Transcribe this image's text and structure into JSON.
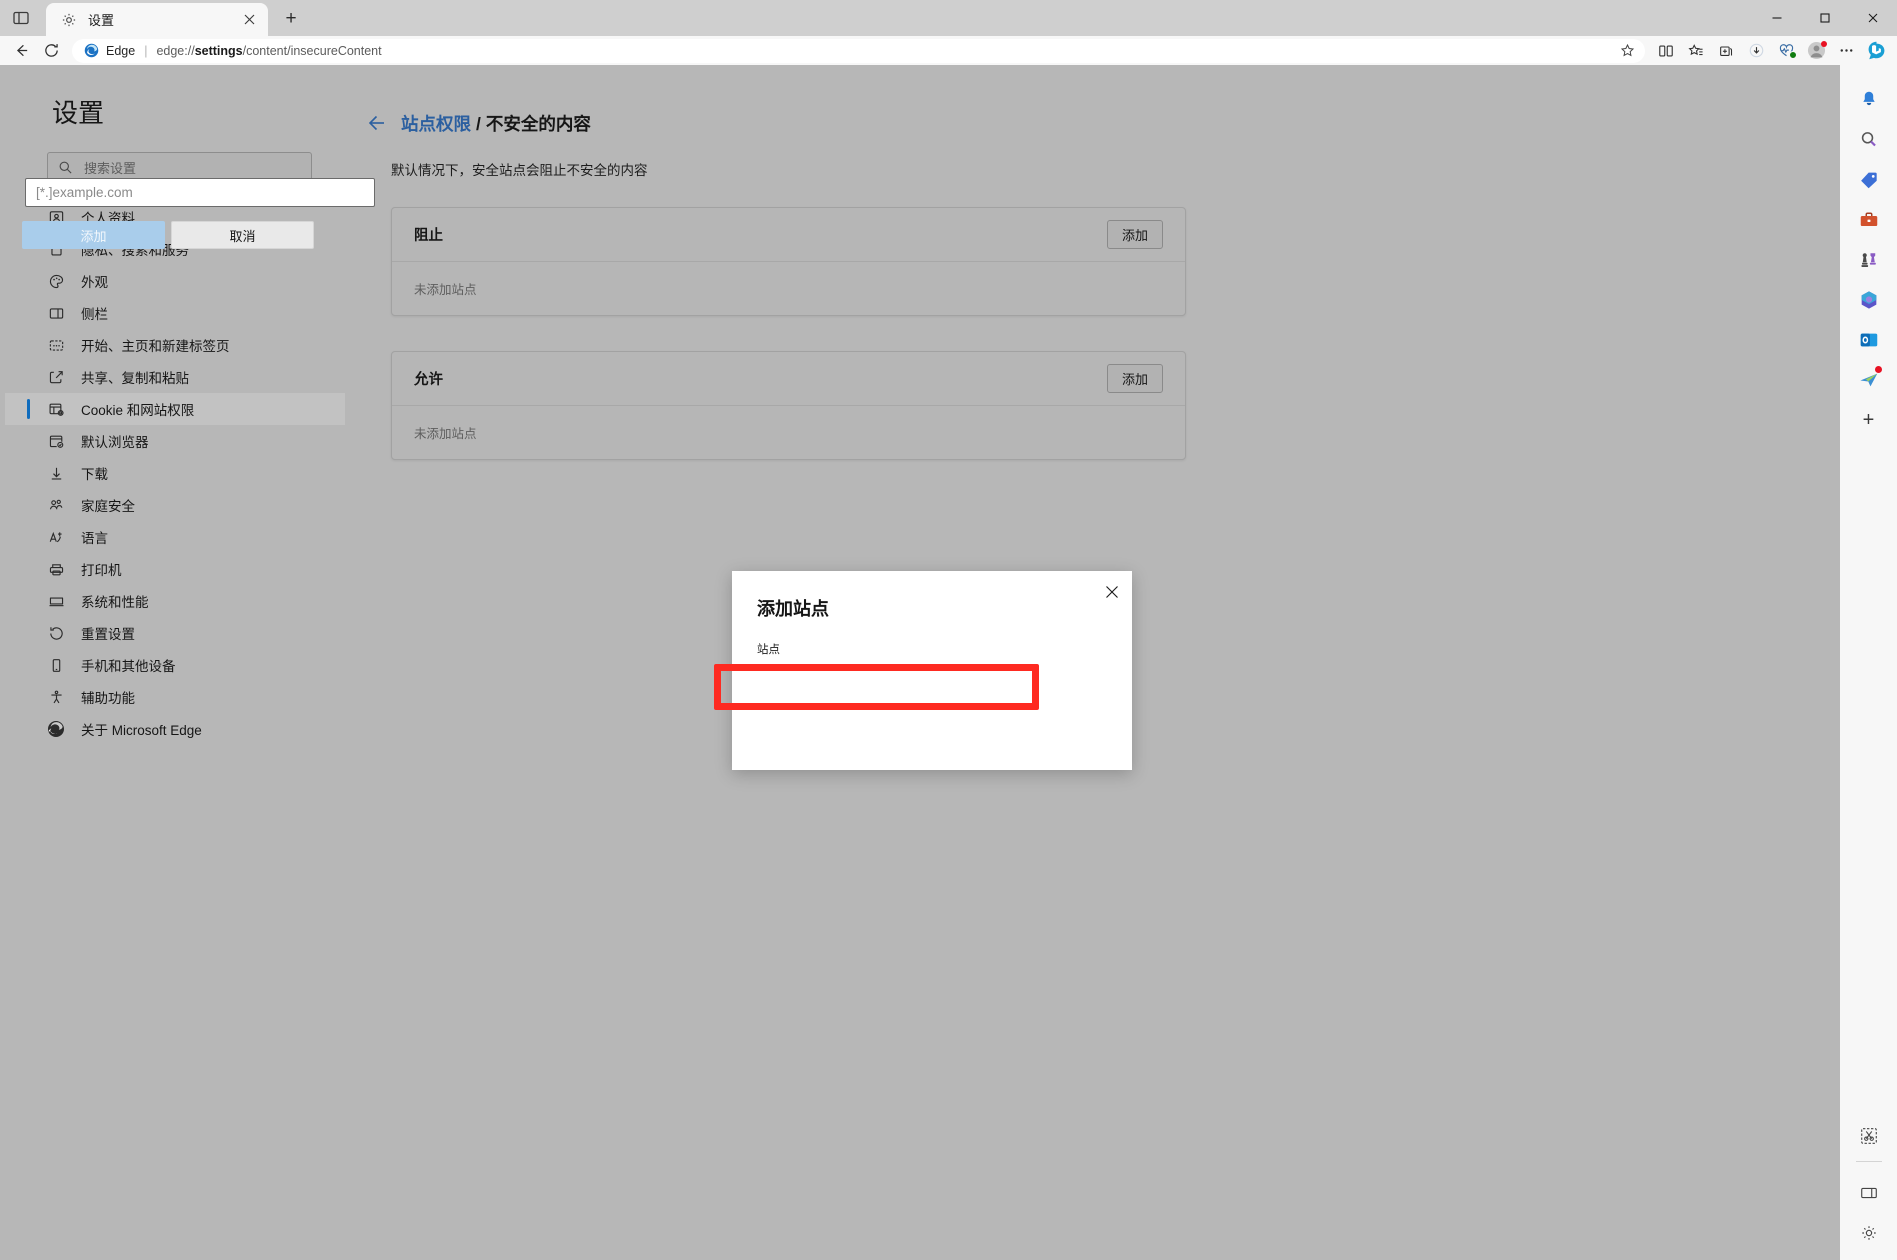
{
  "window": {
    "minimize_label": "Minimize",
    "maximize_label": "Maximize",
    "close_label": "Close"
  },
  "tabstrip": {
    "tab_search_icon": "tab-actions-icon",
    "new_tab_label": "+",
    "tabs": [
      {
        "title": "设置",
        "favicon": "gear-icon",
        "close_label": "✕"
      }
    ]
  },
  "toolbar": {
    "back_label": "←",
    "refresh_label": "⟳",
    "edge_label": "Edge",
    "separator": "|",
    "url_prefix": "edge://",
    "url_bold": "settings",
    "url_suffix": "/content/insecureContent",
    "url_full": "edge://settings/content/insecureContent",
    "favorite_icon": "star-icon",
    "split_screen_icon": "split-screen-icon",
    "favorites_icon": "favorites-list-icon",
    "collections_icon": "collections-icon",
    "downloads_icon": "downloads-icon",
    "performance_icon": "browser-essentials-icon",
    "profile_icon": "profile-avatar-icon",
    "more_icon": "ellipsis-icon",
    "copilot_icon": "bing-copilot-icon"
  },
  "sidebar": {
    "title": "设置",
    "search": {
      "placeholder": "搜索设置",
      "icon": "search-icon",
      "value": ""
    },
    "items": [
      {
        "label": "个人资料",
        "icon": "profile-icon",
        "active": false
      },
      {
        "label": "隐私、搜索和服务",
        "icon": "lock-icon",
        "active": false
      },
      {
        "label": "外观",
        "icon": "palette-icon",
        "active": false
      },
      {
        "label": "侧栏",
        "icon": "sidebar-icon",
        "active": false
      },
      {
        "label": "开始、主页和新建标签页",
        "icon": "home-tabs-icon",
        "active": false
      },
      {
        "label": "共享、复制和粘贴",
        "icon": "share-icon",
        "active": false
      },
      {
        "label": "Cookie 和网站权限",
        "icon": "cookie-permissions-icon",
        "active": true
      },
      {
        "label": "默认浏览器",
        "icon": "default-browser-icon",
        "active": false
      },
      {
        "label": "下载",
        "icon": "download-icon",
        "active": false
      },
      {
        "label": "家庭安全",
        "icon": "family-safety-icon",
        "active": false
      },
      {
        "label": "语言",
        "icon": "language-icon",
        "active": false
      },
      {
        "label": "打印机",
        "icon": "printer-icon",
        "active": false
      },
      {
        "label": "系统和性能",
        "icon": "system-performance-icon",
        "active": false
      },
      {
        "label": "重置设置",
        "icon": "reset-icon",
        "active": false
      },
      {
        "label": "手机和其他设备",
        "icon": "phone-devices-icon",
        "active": false
      },
      {
        "label": "辅助功能",
        "icon": "accessibility-icon",
        "active": false
      },
      {
        "label": "关于 Microsoft Edge",
        "icon": "edge-logo-icon",
        "active": false
      }
    ]
  },
  "main": {
    "back_icon": "back-arrow-icon",
    "breadcrumb": {
      "parent": "站点权限",
      "separator": "/",
      "current": "不安全的内容"
    },
    "description": "默认情况下，安全站点会阻止不安全的内容",
    "sections": [
      {
        "title": "阻止",
        "add_label": "添加",
        "empty_text": "未添加站点"
      },
      {
        "title": "允许",
        "add_label": "添加",
        "empty_text": "未添加站点"
      }
    ]
  },
  "dialog": {
    "title": "添加站点",
    "close_label": "✕",
    "close_icon": "close-icon",
    "field_label": "站点",
    "input_placeholder": "[*.]example.com",
    "input_value": "",
    "primary_label": "添加",
    "secondary_label": "取消",
    "highlight_color": "#fe2a21",
    "primary_color": "#a9cdeb"
  },
  "edgebar": {
    "items": [
      {
        "icon": "notifications-bell-icon",
        "badge": false
      },
      {
        "icon": "search-magnifier-icon",
        "badge": false
      },
      {
        "icon": "shopping-tag-icon",
        "badge": false
      },
      {
        "icon": "tools-briefcase-icon",
        "badge": false
      },
      {
        "icon": "games-chess-icon",
        "badge": false
      },
      {
        "icon": "copilot-icon",
        "badge": false
      },
      {
        "icon": "outlook-icon",
        "badge": false
      },
      {
        "icon": "send-plane-icon",
        "badge": true
      }
    ],
    "add_label": "+",
    "bottom_items": [
      {
        "icon": "screenshot-snip-icon"
      },
      {
        "icon": "sidebar-toggle-icon"
      },
      {
        "icon": "settings-gear-icon"
      }
    ]
  }
}
